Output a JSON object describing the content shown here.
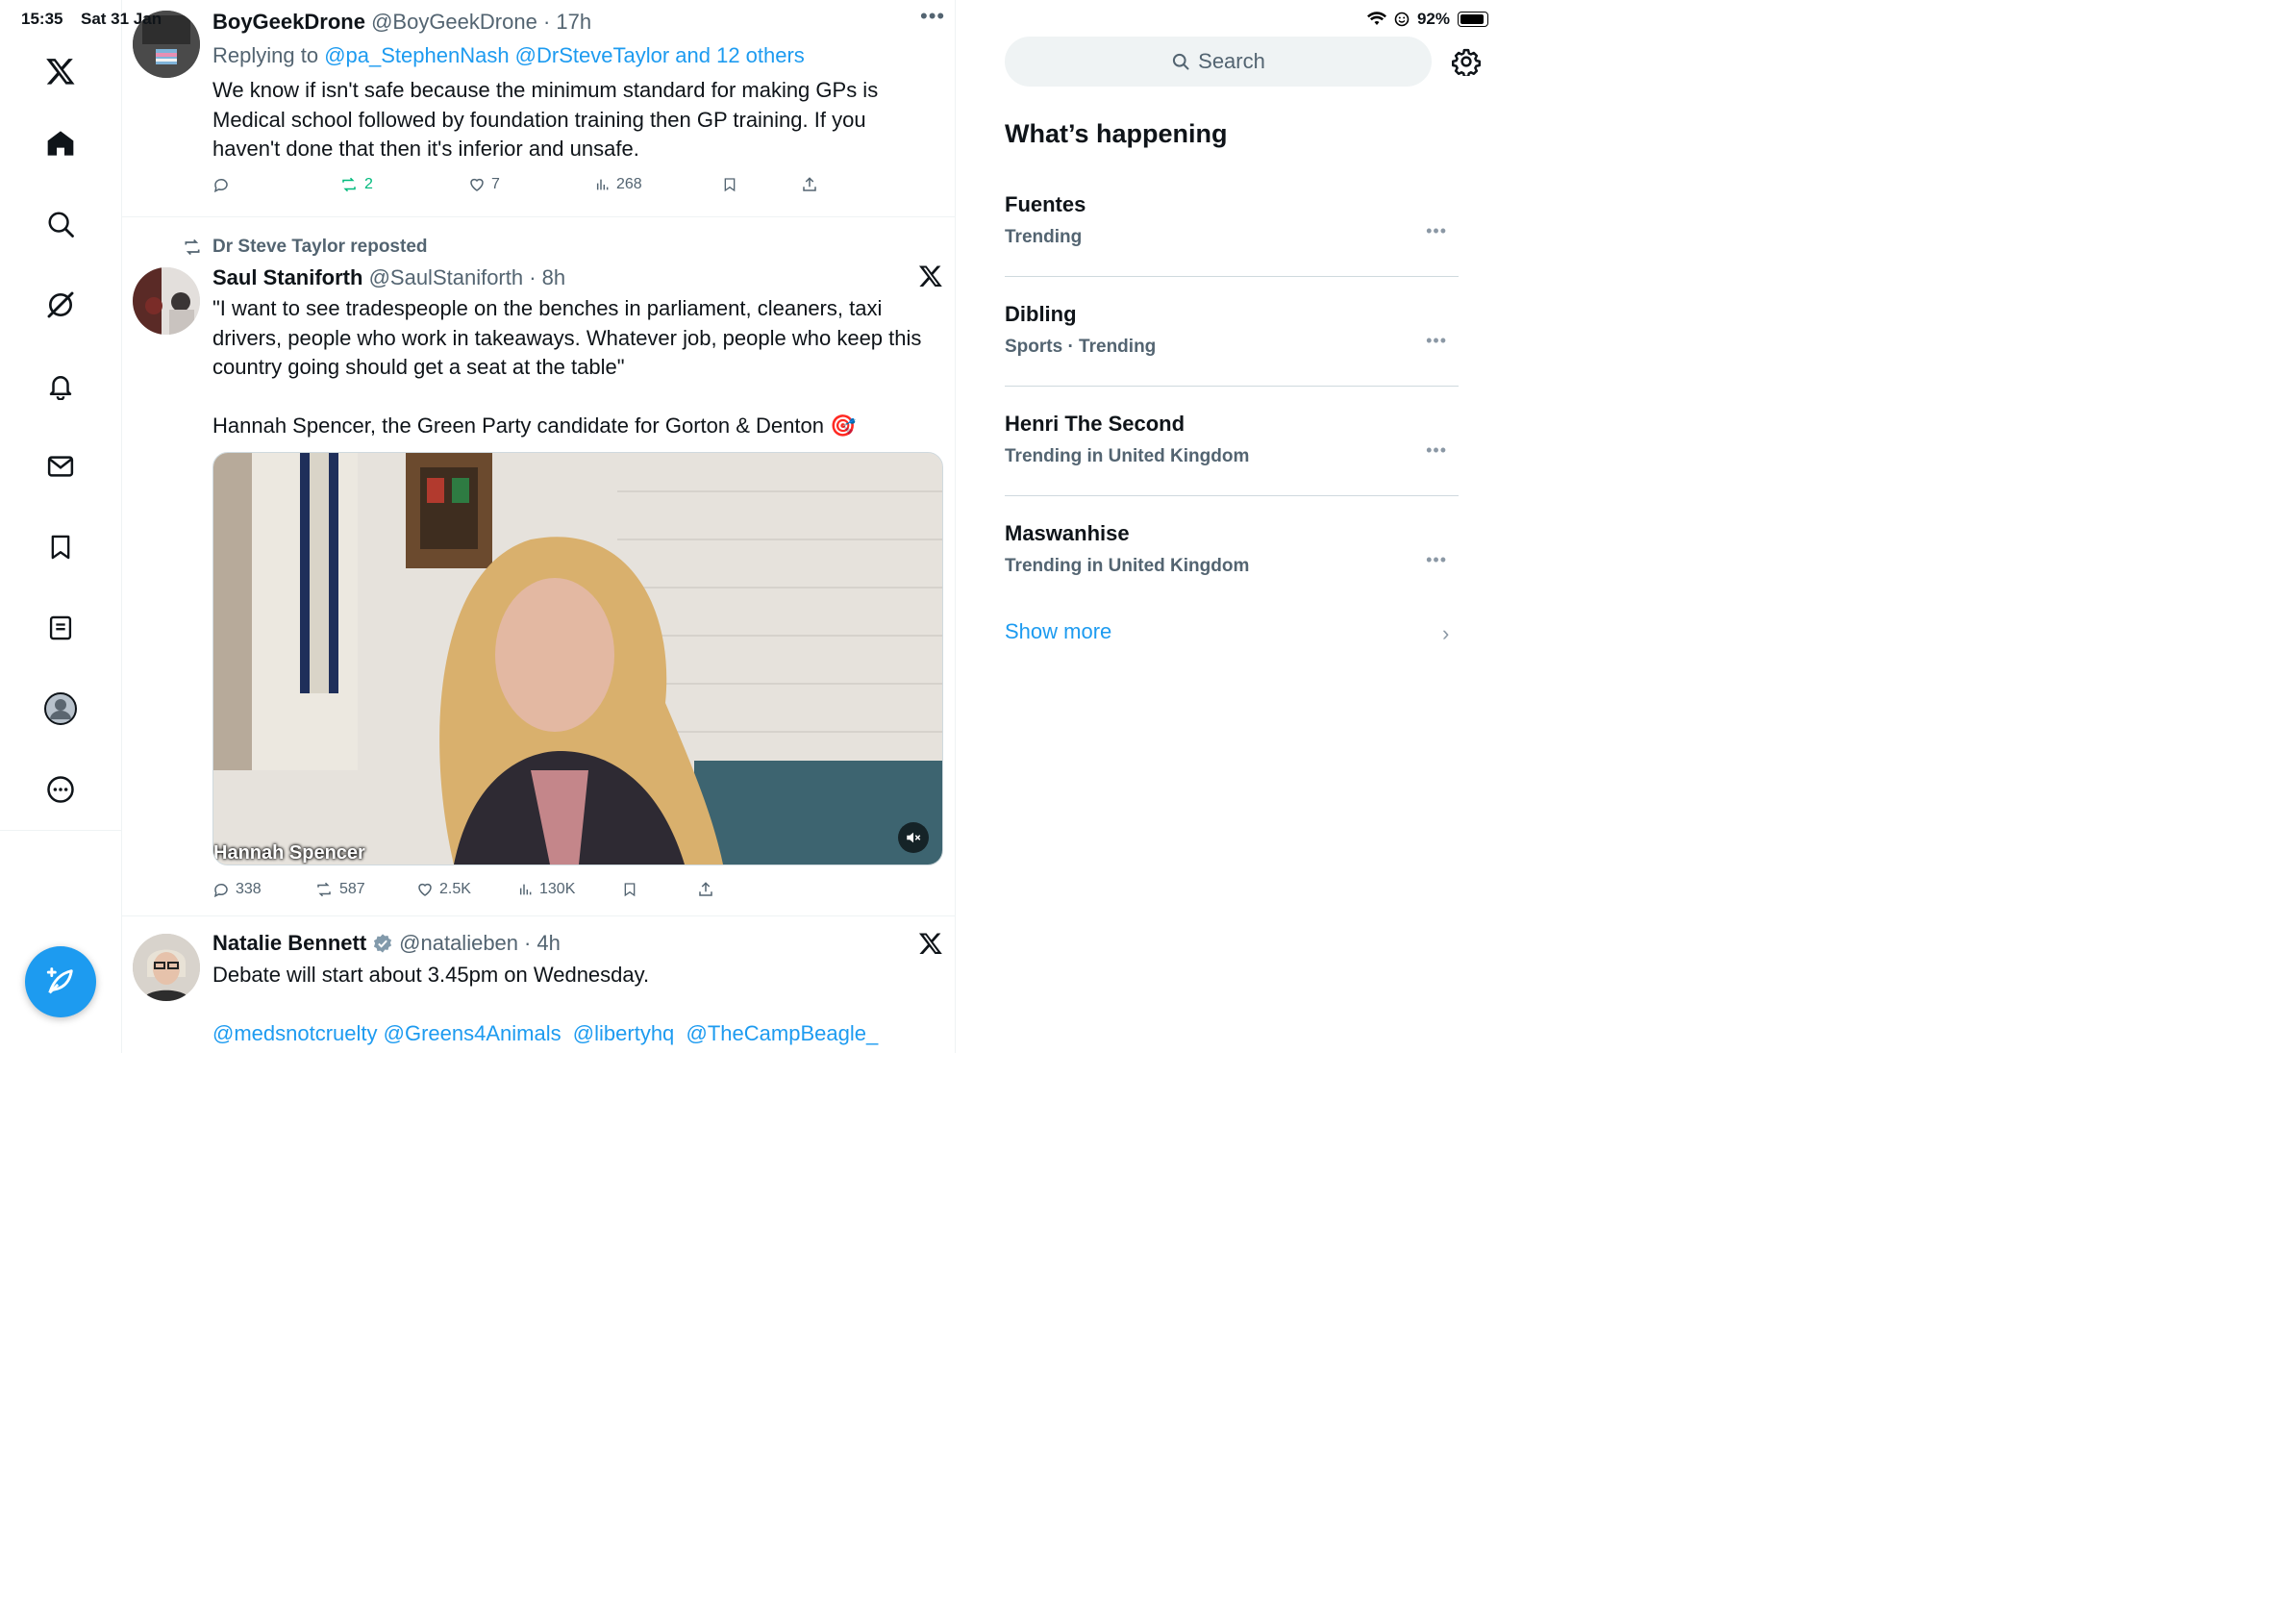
{
  "status": {
    "time": "15:35",
    "date": "Sat 31 Jan",
    "battery": "92%"
  },
  "compose_label": "",
  "tweets": [
    {
      "name": "BoyGeekDrone",
      "handle": "@BoyGeekDrone",
      "age": "17h",
      "reply_prefix": "Replying to ",
      "reply_targets": "@pa_StephenNash @DrSteveTaylor and 12 others",
      "text": "We know if isn't safe because the minimum standard for making GPs is Medical school followed by foundation training then GP training. If you haven't done that then it's inferior and unsafe.",
      "replies": "",
      "reposts": "2",
      "likes": "7",
      "views": "268"
    },
    {
      "repost_note": "Dr Steve Taylor reposted",
      "name": "Saul Staniforth",
      "handle": "@SaulStaniforth",
      "age": "8h",
      "text": "\"I want to see tradespeople on the benches in parliament, cleaners, taxi drivers, people who work in takeaways. Whatever job, people who keep this country going should get a seat at the table\"",
      "text2": "Hannah Spencer, the Green Party candidate for Gorton & Denton 🎯",
      "video_caption": "Hannah Spencer",
      "replies": "338",
      "reposts": "587",
      "likes": "2.5K",
      "views": "130K"
    },
    {
      "name": "Natalie Bennett",
      "handle": "@natalieben",
      "age": "4h",
      "text": "Debate will start about 3.45pm on Wednesday.",
      "mentions": "@medsnotcruelty @Greens4Animals  @libertyhq  @TheCampBeagle_"
    }
  ],
  "search": {
    "placeholder": "Search"
  },
  "whats_happening": {
    "title": "What’s happening",
    "trends": [
      {
        "name": "Fuentes",
        "meta": "Trending"
      },
      {
        "name": "Dibling",
        "meta": "Sports · Trending"
      },
      {
        "name": "Henri The Second",
        "meta": "Trending in United Kingdom"
      },
      {
        "name": "Maswanhise",
        "meta": "Trending in United Kingdom"
      }
    ],
    "show_more": "Show more"
  },
  "colors": {
    "accent": "#1d9bf0",
    "repost_green": "#00ba7c",
    "muted": "#536471"
  }
}
